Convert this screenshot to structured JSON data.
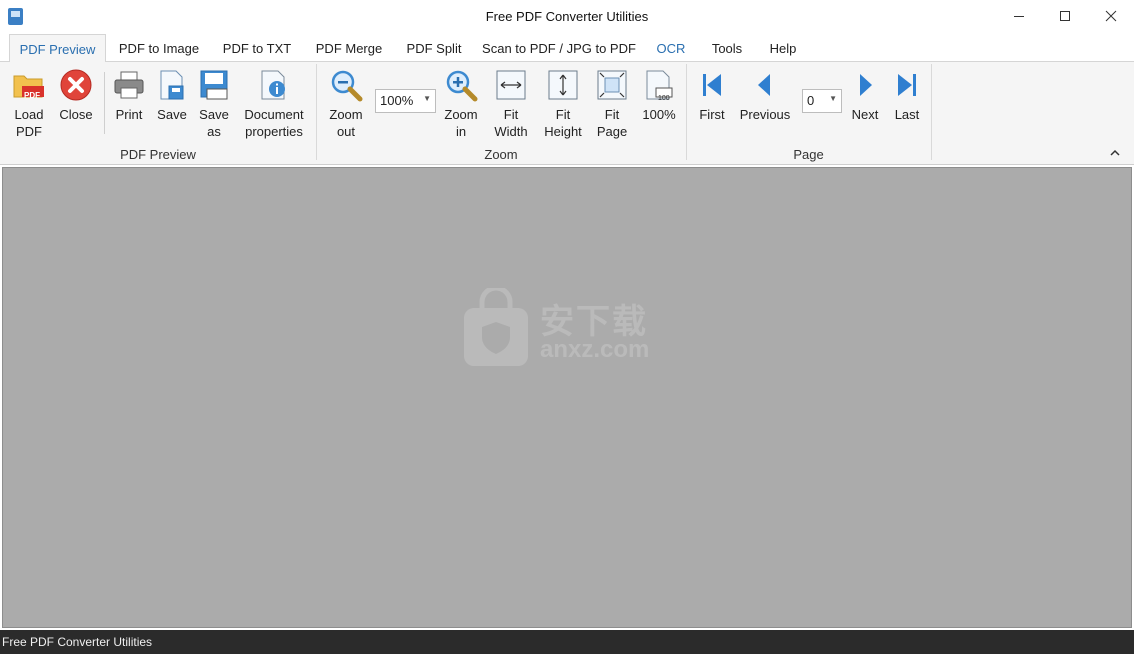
{
  "window": {
    "title": "Free PDF Converter Utilities"
  },
  "tabs": [
    {
      "label": "PDF Preview"
    },
    {
      "label": "PDF to Image"
    },
    {
      "label": "PDF to TXT"
    },
    {
      "label": "PDF Merge"
    },
    {
      "label": "PDF Split"
    },
    {
      "label": "Scan to PDF / JPG to PDF"
    },
    {
      "label": "OCR"
    },
    {
      "label": "Tools"
    },
    {
      "label": "Help"
    }
  ],
  "ribbon": {
    "preview_group": {
      "label": "PDF Preview",
      "load": "Load\nPDF",
      "close": "Close",
      "print": "Print",
      "save": "Save",
      "save_as": "Save\nas",
      "doc_props": "Document\nproperties",
      "pdf_badge": "PDF"
    },
    "zoom_group": {
      "label": "Zoom",
      "zoom_out": "Zoom\nout",
      "zoom_value": "100%",
      "zoom_in": "Zoom\nin",
      "fit_width": "Fit\nWidth",
      "fit_height": "Fit\nHeight",
      "fit_page": "Fit\nPage",
      "actual": "100%",
      "actual_badge": "100"
    },
    "page_group": {
      "label": "Page",
      "first": "First",
      "previous": "Previous",
      "page_value": "0",
      "next": "Next",
      "last": "Last"
    }
  },
  "watermark": {
    "cn": "安下载",
    "en": "anxz.com"
  },
  "statusbar": {
    "text": "Free PDF Converter Utilities"
  },
  "colors": {
    "accent": "#2a6fb0",
    "preview_bg": "#ababab",
    "status_bg": "#2b2b2b",
    "close_red": "#e0443a",
    "nav_blue": "#2f7fd0"
  }
}
